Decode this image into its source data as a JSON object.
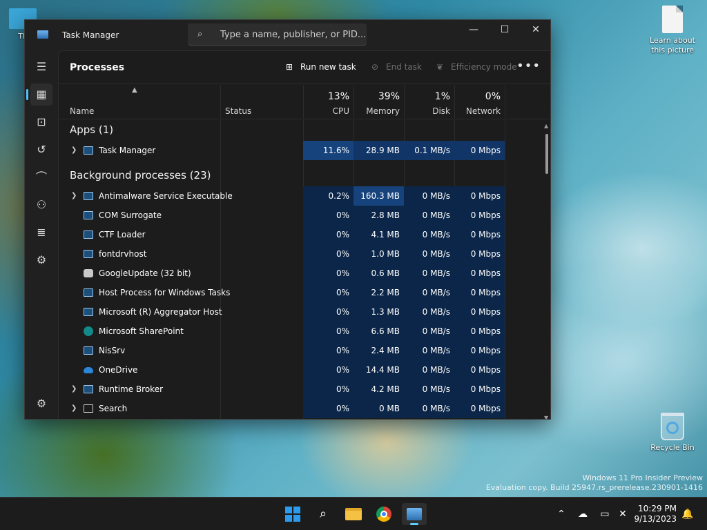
{
  "desktop": {
    "icons": [
      {
        "label": "Th"
      },
      {
        "label": "Learn about this picture"
      },
      {
        "label": "Recycle Bin"
      }
    ],
    "watermark": {
      "line1": "Windows 11 Pro Insider Preview",
      "line2": "Evaluation copy. Build 25947.rs_prerelease.230901-1416"
    }
  },
  "window": {
    "title": "Task Manager",
    "search_placeholder": "Type a name, publisher, or PID...",
    "caption": {
      "minimize": "—",
      "maximize": "☐",
      "close": "✕"
    }
  },
  "toolbar": {
    "page_title": "Processes",
    "run_new_task": "Run new task",
    "end_task": "End task",
    "efficiency_mode": "Efficiency mode",
    "more": "•••"
  },
  "columns": {
    "name": "Name",
    "status": "Status",
    "cpu": {
      "pct": "13%",
      "label": "CPU"
    },
    "memory": {
      "pct": "39%",
      "label": "Memory"
    },
    "disk": {
      "pct": "1%",
      "label": "Disk"
    },
    "network": {
      "pct": "0%",
      "label": "Network"
    }
  },
  "groups": {
    "apps": "Apps (1)",
    "background": "Background processes (23)"
  },
  "apps": [
    {
      "name": "Task Manager",
      "cpu": "11.6%",
      "memory": "28.9 MB",
      "disk": "0.1 MB/s",
      "network": "0 Mbps",
      "expandable": true
    }
  ],
  "background": [
    {
      "name": "Antimalware Service Executable",
      "cpu": "0.2%",
      "memory": "160.3 MB",
      "disk": "0 MB/s",
      "network": "0 Mbps",
      "expandable": true
    },
    {
      "name": "COM Surrogate",
      "cpu": "0%",
      "memory": "2.8 MB",
      "disk": "0 MB/s",
      "network": "0 Mbps"
    },
    {
      "name": "CTF Loader",
      "cpu": "0%",
      "memory": "4.1 MB",
      "disk": "0 MB/s",
      "network": "0 Mbps"
    },
    {
      "name": "fontdrvhost",
      "cpu": "0%",
      "memory": "1.0 MB",
      "disk": "0 MB/s",
      "network": "0 Mbps"
    },
    {
      "name": "GoogleUpdate (32 bit)",
      "cpu": "0%",
      "memory": "0.6 MB",
      "disk": "0 MB/s",
      "network": "0 Mbps"
    },
    {
      "name": "Host Process for Windows Tasks",
      "cpu": "0%",
      "memory": "2.2 MB",
      "disk": "0 MB/s",
      "network": "0 Mbps"
    },
    {
      "name": "Microsoft (R) Aggregator Host",
      "cpu": "0%",
      "memory": "1.3 MB",
      "disk": "0 MB/s",
      "network": "0 Mbps"
    },
    {
      "name": "Microsoft SharePoint",
      "cpu": "0%",
      "memory": "6.6 MB",
      "disk": "0 MB/s",
      "network": "0 Mbps"
    },
    {
      "name": "NisSrv",
      "cpu": "0%",
      "memory": "2.4 MB",
      "disk": "0 MB/s",
      "network": "0 Mbps"
    },
    {
      "name": "OneDrive",
      "cpu": "0%",
      "memory": "14.4 MB",
      "disk": "0 MB/s",
      "network": "0 Mbps"
    },
    {
      "name": "Runtime Broker",
      "cpu": "0%",
      "memory": "4.2 MB",
      "disk": "0 MB/s",
      "network": "0 Mbps",
      "expandable": true
    },
    {
      "name": "Search",
      "cpu": "0%",
      "memory": "0 MB",
      "disk": "0 MB/s",
      "network": "0 Mbps",
      "expandable": true
    }
  ],
  "taskbar": {
    "clock_time": "10:29 PM",
    "clock_date": "9/13/2023"
  },
  "colors": {
    "accent": "#4cc2ff",
    "heat_low": "#0b2648",
    "heat_mid": "#113566",
    "heat_high": "#17437d"
  }
}
